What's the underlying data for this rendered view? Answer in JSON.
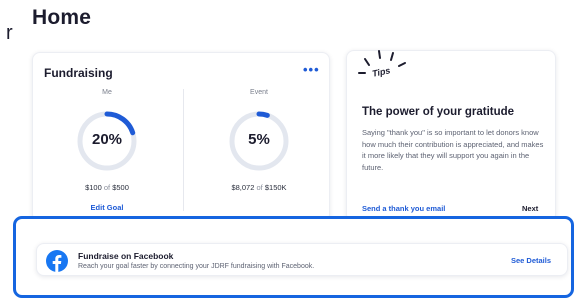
{
  "edge_char": "r",
  "page_title": "Home",
  "fundraising": {
    "title": "Fundraising",
    "me": {
      "label": "Me",
      "percent_text": "20%",
      "progress": 0.2,
      "raised": "$100",
      "of": "of",
      "goal": "$500",
      "action": "Edit Goal"
    },
    "event": {
      "label": "Event",
      "percent_text": "5%",
      "progress": 0.05,
      "raised": "$8,072",
      "of": "of",
      "goal": "$150K"
    }
  },
  "tips": {
    "badge": "Tips",
    "heading": "The power of your gratitude",
    "body": "Saying \"thank you\" is so important to let donors know how much their contribution is appreciated, and makes it more likely that they will support you again in the future.",
    "link": "Send a thank you email",
    "next": "Next"
  },
  "facebook": {
    "title": "Fundraise on Facebook",
    "description": "Reach your goal faster by connecting your JDRF fundraising with Facebook.",
    "link": "See Details"
  },
  "colors": {
    "accent": "#1f5bd6",
    "highlight": "#1565e0",
    "facebook": "#1877f2",
    "ring_track": "#e3e7ef"
  }
}
